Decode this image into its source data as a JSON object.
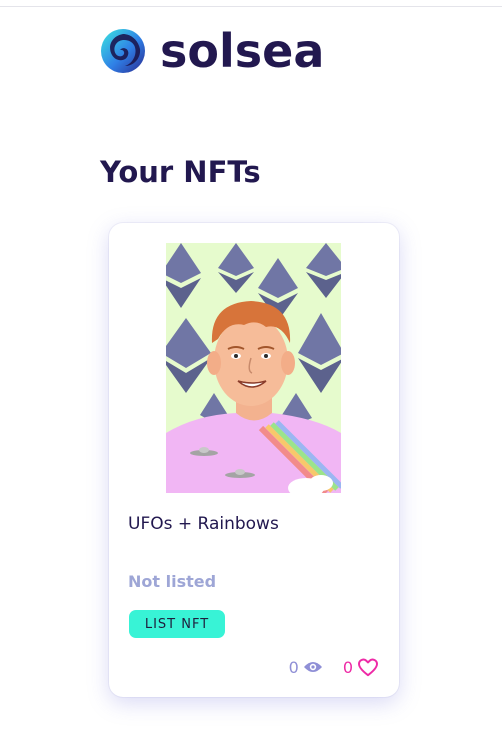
{
  "brand": {
    "name": "solsea",
    "colors": {
      "text": "#22184f",
      "accent": "#38f3d6",
      "likes": "#ee2aa6",
      "views": "#8f8fd6"
    }
  },
  "page": {
    "title": "Your NFTs"
  },
  "nfts": [
    {
      "name": "UFOs + Rainbows",
      "status": "Not listed",
      "action_label": "LIST NFT",
      "views": "0",
      "likes": "0",
      "view_icon": "eye-icon",
      "like_icon": "heart-icon"
    }
  ]
}
